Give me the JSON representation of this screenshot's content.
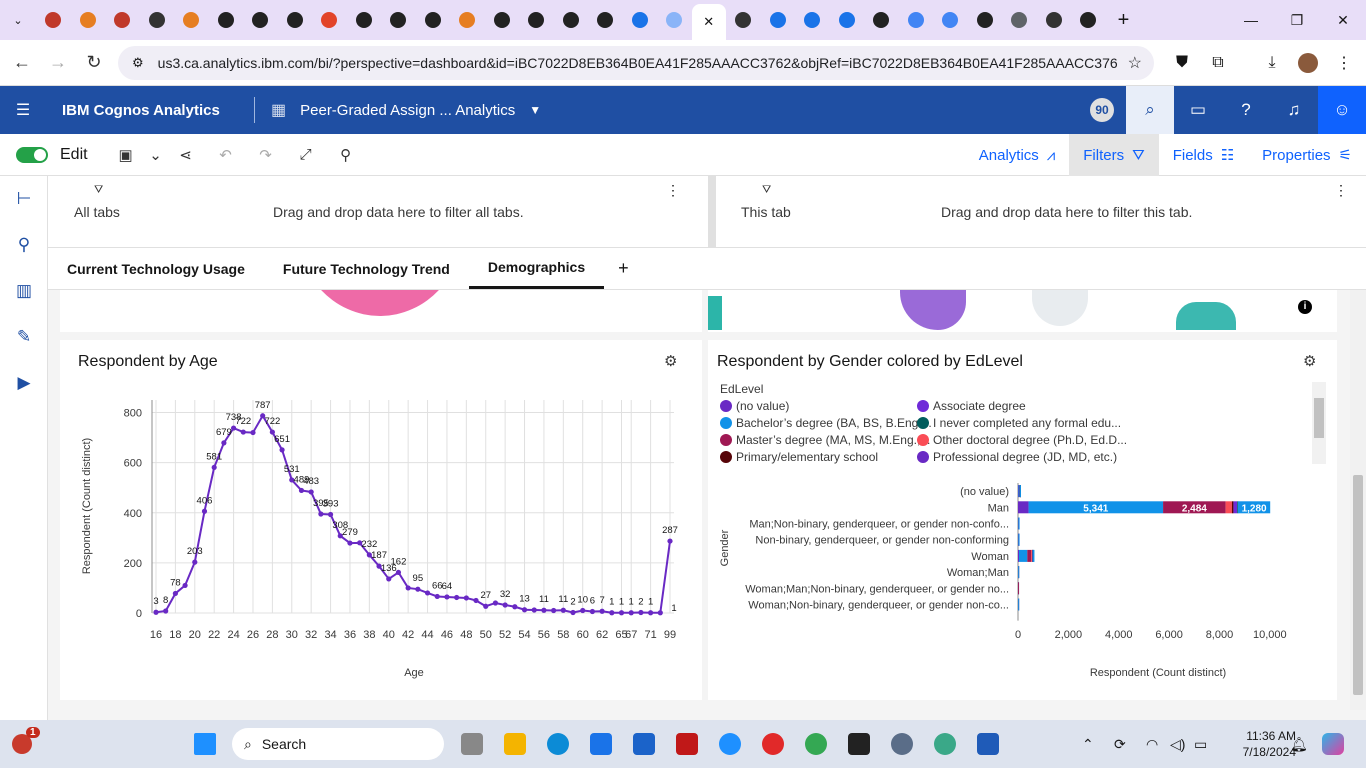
{
  "browser": {
    "url": "us3.ca.analytics.ibm.com/bi/?perspective=dashboard&id=iBC7022D8EB364B0EA41F285AAACC3762&objRef=iBC7022D8EB364B0EA41F285AAACC3762&o...",
    "tab_icon_colors": [
      "#c0392b",
      "#e67e22",
      "#c0392b",
      "#333",
      "#e67e22",
      "#222",
      "#222",
      "#222",
      "#e24329",
      "#222",
      "#222",
      "#222",
      "#e67e22",
      "#222",
      "#222",
      "#222",
      "#222",
      "#1a73e8",
      "#8ab4f8",
      "#ffffff",
      "#333",
      "#1a73e8",
      "#1a73e8",
      "#1a73e8",
      "#222",
      "#4285f4",
      "#4285f4",
      "#222",
      "#5f6368",
      "#333",
      "#222"
    ]
  },
  "app": {
    "brand": "IBM Cognos Analytics",
    "dashboard_title": "Peer-Graded Assign ... Analytics",
    "notification_count": "90"
  },
  "toolbar": {
    "edit_label": "Edit",
    "analytics_label": "Analytics",
    "filters_label": "Filters",
    "fields_label": "Fields",
    "properties_label": "Properties"
  },
  "filters": {
    "all_tabs_label": "All tabs",
    "all_tabs_drop": "Drag and drop data here to filter all tabs.",
    "this_tab_label": "This tab",
    "this_tab_drop": "Drag and drop data here to filter this tab."
  },
  "tabs": [
    "Current Technology Usage",
    "Future Technology Trend",
    "Demographics"
  ],
  "age_chart": {
    "title": "Respondent by Age",
    "xlabel": "Age",
    "ylabel": "Respondent (Count distinct)"
  },
  "gender_chart": {
    "title": "Respondent by Gender colored by EdLevel",
    "legend_title": "EdLevel",
    "xlabel": "Respondent (Count distinct)",
    "ylabel": "Gender"
  },
  "chart_data": [
    {
      "type": "line",
      "title": "Respondent by Age",
      "xlabel": "Age",
      "ylabel": "Respondent (Count distinct)",
      "ylim": [
        0,
        850
      ],
      "yticks": [
        0,
        200,
        400,
        600,
        800
      ],
      "x_tick_labels": [
        "16",
        "18",
        "20",
        "22",
        "24",
        "26",
        "28",
        "30",
        "32",
        "34",
        "36",
        "38",
        "40",
        "42",
        "44",
        "46",
        "48",
        "50",
        "52",
        "54",
        "56",
        "58",
        "60",
        "62",
        "65",
        "67",
        "71",
        "99"
      ],
      "points": [
        {
          "age": "16",
          "value": 3,
          "label": "3"
        },
        {
          "age": "17",
          "value": 8,
          "label": "8"
        },
        {
          "age": "18",
          "value": 78,
          "label": "78"
        },
        {
          "age": "19",
          "value": 110
        },
        {
          "age": "20",
          "value": 203,
          "label": "203"
        },
        {
          "age": "21",
          "value": 406,
          "label": "406"
        },
        {
          "age": "22",
          "value": 581,
          "label": "581"
        },
        {
          "age": "23",
          "value": 679,
          "label": "679"
        },
        {
          "age": "24",
          "value": 738,
          "label": "738"
        },
        {
          "age": "25",
          "value": 722,
          "label": "722"
        },
        {
          "age": "26",
          "value": 720
        },
        {
          "age": "27",
          "value": 787,
          "label": "787"
        },
        {
          "age": "28",
          "value": 722,
          "label": "722"
        },
        {
          "age": "29",
          "value": 651,
          "label": "651"
        },
        {
          "age": "30",
          "value": 531,
          "label": "531"
        },
        {
          "age": "31",
          "value": 489,
          "label": "489"
        },
        {
          "age": "32",
          "value": 483,
          "label": "483"
        },
        {
          "age": "33",
          "value": 395,
          "label": "395"
        },
        {
          "age": "34",
          "value": 393,
          "label": "393"
        },
        {
          "age": "35",
          "value": 308,
          "label": "308"
        },
        {
          "age": "36",
          "value": 279,
          "label": "279"
        },
        {
          "age": "37",
          "value": 280
        },
        {
          "age": "38",
          "value": 232,
          "label": "232"
        },
        {
          "age": "39",
          "value": 187,
          "label": "187"
        },
        {
          "age": "40",
          "value": 136,
          "label": "136"
        },
        {
          "age": "41",
          "value": 162,
          "label": "162"
        },
        {
          "age": "42",
          "value": 100
        },
        {
          "age": "43",
          "value": 95,
          "label": "95"
        },
        {
          "age": "44",
          "value": 80
        },
        {
          "age": "45",
          "value": 66,
          "label": "66"
        },
        {
          "age": "46",
          "value": 64,
          "label": "64"
        },
        {
          "age": "47",
          "value": 62
        },
        {
          "age": "48",
          "value": 60
        },
        {
          "age": "49",
          "value": 50
        },
        {
          "age": "50",
          "value": 27,
          "label": "27"
        },
        {
          "age": "51",
          "value": 40
        },
        {
          "age": "52",
          "value": 32,
          "label": "32"
        },
        {
          "age": "53",
          "value": 25
        },
        {
          "age": "54",
          "value": 13,
          "label": "13"
        },
        {
          "age": "55",
          "value": 12
        },
        {
          "age": "56",
          "value": 11,
          "label": "11"
        },
        {
          "age": "57",
          "value": 10
        },
        {
          "age": "58",
          "value": 11,
          "label": "11"
        },
        {
          "age": "59",
          "value": 2,
          "label": "2"
        },
        {
          "age": "60",
          "value": 10,
          "label": "10"
        },
        {
          "age": "61",
          "value": 6,
          "label": "6"
        },
        {
          "age": "62",
          "value": 7,
          "label": "7"
        },
        {
          "age": "63",
          "value": 1,
          "label": "1"
        },
        {
          "age": "65",
          "value": 1,
          "label": "1"
        },
        {
          "age": "67",
          "value": 1,
          "label": "1"
        },
        {
          "age": "69",
          "value": 2,
          "label": "2"
        },
        {
          "age": "71",
          "value": 1,
          "label": "1"
        },
        {
          "age": "79",
          "value": 1
        },
        {
          "age": "99",
          "value": 287,
          "label": "287"
        }
      ],
      "end_label": "1",
      "grid": true,
      "color": "#6929c4"
    },
    {
      "type": "bar",
      "orientation": "horizontal",
      "stacked": true,
      "title": "Respondent by Gender colored by EdLevel",
      "xlabel": "Respondent (Count distinct)",
      "ylabel": "Gender",
      "xlim": [
        0,
        11000
      ],
      "xticks": [
        "0",
        "2,000",
        "4,000",
        "6,000",
        "8,000",
        "10,000"
      ],
      "xtick_values": [
        0,
        2000,
        4000,
        6000,
        8000,
        10000
      ],
      "categories": [
        "(no value)",
        "Man",
        "Man;Non-binary, genderqueer, or gender non-confo...",
        "Non-binary, genderqueer, or gender non-conforming",
        "Woman",
        "Woman;Man",
        "Woman;Man;Non-binary, genderqueer, or gender no...",
        "Woman;Non-binary, genderqueer, or gender non-co..."
      ],
      "series": [
        {
          "name": "(no value)",
          "color": "#6929c4",
          "values": [
            20,
            420,
            5,
            5,
            40,
            2,
            1,
            2
          ]
        },
        {
          "name": "Bachelor’s degree (BA, BS, B.Eng....",
          "color": "#1192e8",
          "values": [
            40,
            5341,
            10,
            10,
            330,
            5,
            1,
            3
          ],
          "label_man": "5,341"
        },
        {
          "name": "Master’s degree (MA, MS, M.Eng.,...",
          "color": "#9f1853",
          "values": [
            10,
            2484,
            5,
            5,
            150,
            2,
            1,
            2
          ],
          "label_man": "2,484"
        },
        {
          "name": "Other doctoral degree (Ph.D, Ed.D...",
          "color": "#fa4d56",
          "values": [
            2,
            250,
            1,
            1,
            40,
            0,
            0,
            0
          ]
        },
        {
          "name": "Primary/elementary school",
          "color": "#570408",
          "values": [
            2,
            60,
            0,
            0,
            5,
            0,
            0,
            0
          ]
        },
        {
          "name": "Associate degree",
          "color": "#6f2ad8",
          "values": [
            2,
            150,
            1,
            1,
            15,
            0,
            0,
            0
          ]
        },
        {
          "name": "I never completed any formal edu...",
          "color": "#005d5d",
          "values": [
            1,
            30,
            0,
            0,
            3,
            0,
            0,
            0
          ]
        },
        {
          "name": "Professional degree (JD, MD, etc.)",
          "color": "#1192e8",
          "values": [
            3,
            1280,
            2,
            2,
            70,
            1,
            0,
            1
          ],
          "label_man": "1,280"
        }
      ]
    }
  ],
  "legend": [
    {
      "name": "(no value)",
      "color": "#6929c4"
    },
    {
      "name": "Associate degree",
      "color": "#6f2ad8"
    },
    {
      "name": "Bachelor’s degree (BA, BS, B.Eng....",
      "color": "#1192e8"
    },
    {
      "name": "I never completed any formal edu...",
      "color": "#005d5d"
    },
    {
      "name": "Master’s degree (MA, MS, M.Eng.,...",
      "color": "#9f1853"
    },
    {
      "name": "Other doctoral degree (Ph.D, Ed.D...",
      "color": "#fa4d56"
    },
    {
      "name": "Primary/elementary school",
      "color": "#570408"
    },
    {
      "name": "Professional degree (JD, MD, etc.)",
      "color": "#6929c4"
    }
  ],
  "taskbar": {
    "search_placeholder": "Search",
    "time": "11:36 AM",
    "date": "7/18/2024",
    "notification_badge": "1"
  }
}
